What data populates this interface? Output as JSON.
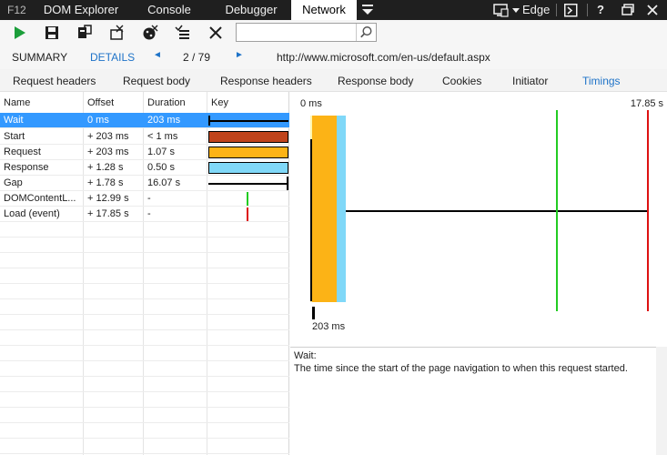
{
  "top_tabs": {
    "f12": "F12",
    "tabs": [
      "DOM Explorer",
      "Console",
      "Debugger",
      "Network"
    ],
    "active": "Network",
    "browser_mode": "Edge",
    "help": "?"
  },
  "toolbar": {
    "search_value": "",
    "search_placeholder": ""
  },
  "summary_bar": {
    "summary": "SUMMARY",
    "details": "DETAILS",
    "prev": "◄",
    "position": "2 / 79",
    "next": "►",
    "url": "http://www.microsoft.com/en-us/default.aspx"
  },
  "detail_tabs": {
    "tabs": [
      "Request headers",
      "Request body",
      "Response headers",
      "Response body",
      "Cookies",
      "Initiator",
      "Timings"
    ],
    "active": "Timings"
  },
  "table": {
    "headers": [
      "Name",
      "Offset",
      "Duration",
      "Key"
    ],
    "rows": [
      {
        "name": "Wait",
        "offset": "0 ms",
        "duration": "203 ms",
        "key_color": "#000000"
      },
      {
        "name": "Start",
        "offset": "+ 203 ms",
        "duration": "< 1 ms",
        "key_color": "#c0441c"
      },
      {
        "name": "Request",
        "offset": "+ 203 ms",
        "duration": "1.07 s",
        "key_color": "#fcb316"
      },
      {
        "name": "Response",
        "offset": "+ 1.28 s",
        "duration": "0.50 s",
        "key_color": "#80d8f8"
      },
      {
        "name": "Gap",
        "offset": "+ 1.78 s",
        "duration": "16.07 s",
        "key_color": "#000000"
      },
      {
        "name": "DOMContentL...",
        "offset": "+ 12.99 s",
        "duration": "-",
        "key_color": "#22cc22"
      },
      {
        "name": "Load (event)",
        "offset": "+ 17.85 s",
        "duration": "-",
        "key_color": "#dd1111"
      }
    ]
  },
  "timeline": {
    "start_label": "0 ms",
    "end_label": "17.85 s",
    "selection_label": "203 ms"
  },
  "description": {
    "title": "Wait:",
    "text": "The time since the start of the page navigation to when this request started."
  }
}
